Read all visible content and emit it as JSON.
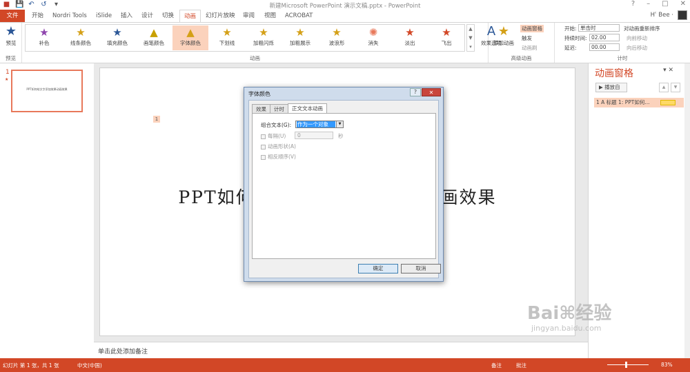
{
  "window": {
    "title": "新建Microsoft PowerPoint 演示文稿.pptx - PowerPoint",
    "controls": [
      "?",
      "–",
      "□",
      "✕"
    ]
  },
  "qat": {
    "icons": [
      "ppt-icon",
      "save-icon",
      "undo-icon",
      "redo-icon",
      "customize-icon"
    ]
  },
  "tabs": {
    "file": "文件",
    "items": [
      "开始",
      "Nordri Tools",
      "iSlide",
      "插入",
      "设计",
      "切换",
      "动画",
      "幻灯片放映",
      "审阅",
      "视图",
      "ACROBAT"
    ],
    "active": "动画"
  },
  "user": {
    "name": "Hʿ Bee ·"
  },
  "ribbon": {
    "preview": {
      "label": "预览",
      "group": "预览"
    },
    "gallery_group": "动画",
    "gallery": [
      "补色",
      "线条颜色",
      "填充颜色",
      "画笔颜色",
      "字体颜色",
      "下划线",
      "加粗闪烁",
      "加粗展示",
      "波浪形",
      "消失",
      "淡出",
      "飞出"
    ],
    "gallery_selected": "字体颜色",
    "effect_options": "效果选项",
    "advanced": {
      "group": "高级动画",
      "add_animation": "添加动画",
      "pane": "动画窗格",
      "trigger": "触发",
      "painter": "动画刷"
    },
    "timing": {
      "group": "计时",
      "start_label": "开始:",
      "start_value": "单击时",
      "duration_label": "持续时间:",
      "duration_value": "02.00",
      "delay_label": "延迟:",
      "delay_value": "00.00",
      "reorder": "对动画重新排序",
      "move_earlier": "向前移动",
      "move_later": "向后移动"
    }
  },
  "thumbs": {
    "number": "1",
    "star": "★",
    "text": "PPT如何给文字添加效果动画效果"
  },
  "slide": {
    "main_left": "PPT如何",
    "main_right": "画效果",
    "anim_tag": "1"
  },
  "notes": {
    "placeholder": "单击此处添加备注"
  },
  "anim_pane": {
    "title": "动画窗格",
    "play": "播放自",
    "item": "1 A  标题 1: PPT如何..."
  },
  "status": {
    "slide": "幻灯片 第 1 张，共 1 张",
    "lang": "中文(中国)",
    "notes": "备注",
    "comments": "批注",
    "zoom": "83%"
  },
  "dialog": {
    "title": "字体颜色",
    "tabs": [
      "效果",
      "计时",
      "正文文本动画"
    ],
    "active_tab": "正文文本动画",
    "group_text_label": "组合文本(G):",
    "group_text_value": "作为一个对象",
    "every_label": "每隔(U)",
    "every_value": "0",
    "every_unit": "秒",
    "animate_shape": "动画形状(A)",
    "reverse_order": "相反顺序(V)",
    "ok": "确定",
    "cancel": "取消"
  },
  "watermark": {
    "main": "Bai⌘经验",
    "url": "jingyan.baidu.com"
  },
  "colors": {
    "accent": "#d24726",
    "selection": "#fbd2bc",
    "dialog_frame": "#cfdcec"
  }
}
